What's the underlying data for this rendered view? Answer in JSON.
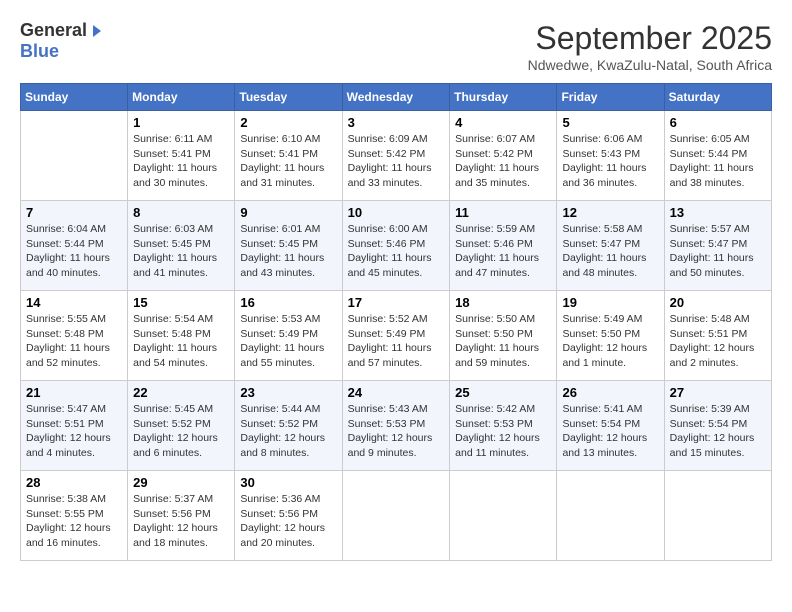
{
  "header": {
    "logo_general": "General",
    "logo_blue": "Blue",
    "month_title": "September 2025",
    "subtitle": "Ndwedwe, KwaZulu-Natal, South Africa"
  },
  "weekdays": [
    "Sunday",
    "Monday",
    "Tuesday",
    "Wednesday",
    "Thursday",
    "Friday",
    "Saturday"
  ],
  "weeks": [
    [
      {
        "day": "",
        "info": ""
      },
      {
        "day": "1",
        "info": "Sunrise: 6:11 AM\nSunset: 5:41 PM\nDaylight: 11 hours\nand 30 minutes."
      },
      {
        "day": "2",
        "info": "Sunrise: 6:10 AM\nSunset: 5:41 PM\nDaylight: 11 hours\nand 31 minutes."
      },
      {
        "day": "3",
        "info": "Sunrise: 6:09 AM\nSunset: 5:42 PM\nDaylight: 11 hours\nand 33 minutes."
      },
      {
        "day": "4",
        "info": "Sunrise: 6:07 AM\nSunset: 5:42 PM\nDaylight: 11 hours\nand 35 minutes."
      },
      {
        "day": "5",
        "info": "Sunrise: 6:06 AM\nSunset: 5:43 PM\nDaylight: 11 hours\nand 36 minutes."
      },
      {
        "day": "6",
        "info": "Sunrise: 6:05 AM\nSunset: 5:44 PM\nDaylight: 11 hours\nand 38 minutes."
      }
    ],
    [
      {
        "day": "7",
        "info": "Sunrise: 6:04 AM\nSunset: 5:44 PM\nDaylight: 11 hours\nand 40 minutes."
      },
      {
        "day": "8",
        "info": "Sunrise: 6:03 AM\nSunset: 5:45 PM\nDaylight: 11 hours\nand 41 minutes."
      },
      {
        "day": "9",
        "info": "Sunrise: 6:01 AM\nSunset: 5:45 PM\nDaylight: 11 hours\nand 43 minutes."
      },
      {
        "day": "10",
        "info": "Sunrise: 6:00 AM\nSunset: 5:46 PM\nDaylight: 11 hours\nand 45 minutes."
      },
      {
        "day": "11",
        "info": "Sunrise: 5:59 AM\nSunset: 5:46 PM\nDaylight: 11 hours\nand 47 minutes."
      },
      {
        "day": "12",
        "info": "Sunrise: 5:58 AM\nSunset: 5:47 PM\nDaylight: 11 hours\nand 48 minutes."
      },
      {
        "day": "13",
        "info": "Sunrise: 5:57 AM\nSunset: 5:47 PM\nDaylight: 11 hours\nand 50 minutes."
      }
    ],
    [
      {
        "day": "14",
        "info": "Sunrise: 5:55 AM\nSunset: 5:48 PM\nDaylight: 11 hours\nand 52 minutes."
      },
      {
        "day": "15",
        "info": "Sunrise: 5:54 AM\nSunset: 5:48 PM\nDaylight: 11 hours\nand 54 minutes."
      },
      {
        "day": "16",
        "info": "Sunrise: 5:53 AM\nSunset: 5:49 PM\nDaylight: 11 hours\nand 55 minutes."
      },
      {
        "day": "17",
        "info": "Sunrise: 5:52 AM\nSunset: 5:49 PM\nDaylight: 11 hours\nand 57 minutes."
      },
      {
        "day": "18",
        "info": "Sunrise: 5:50 AM\nSunset: 5:50 PM\nDaylight: 11 hours\nand 59 minutes."
      },
      {
        "day": "19",
        "info": "Sunrise: 5:49 AM\nSunset: 5:50 PM\nDaylight: 12 hours\nand 1 minute."
      },
      {
        "day": "20",
        "info": "Sunrise: 5:48 AM\nSunset: 5:51 PM\nDaylight: 12 hours\nand 2 minutes."
      }
    ],
    [
      {
        "day": "21",
        "info": "Sunrise: 5:47 AM\nSunset: 5:51 PM\nDaylight: 12 hours\nand 4 minutes."
      },
      {
        "day": "22",
        "info": "Sunrise: 5:45 AM\nSunset: 5:52 PM\nDaylight: 12 hours\nand 6 minutes."
      },
      {
        "day": "23",
        "info": "Sunrise: 5:44 AM\nSunset: 5:52 PM\nDaylight: 12 hours\nand 8 minutes."
      },
      {
        "day": "24",
        "info": "Sunrise: 5:43 AM\nSunset: 5:53 PM\nDaylight: 12 hours\nand 9 minutes."
      },
      {
        "day": "25",
        "info": "Sunrise: 5:42 AM\nSunset: 5:53 PM\nDaylight: 12 hours\nand 11 minutes."
      },
      {
        "day": "26",
        "info": "Sunrise: 5:41 AM\nSunset: 5:54 PM\nDaylight: 12 hours\nand 13 minutes."
      },
      {
        "day": "27",
        "info": "Sunrise: 5:39 AM\nSunset: 5:54 PM\nDaylight: 12 hours\nand 15 minutes."
      }
    ],
    [
      {
        "day": "28",
        "info": "Sunrise: 5:38 AM\nSunset: 5:55 PM\nDaylight: 12 hours\nand 16 minutes."
      },
      {
        "day": "29",
        "info": "Sunrise: 5:37 AM\nSunset: 5:56 PM\nDaylight: 12 hours\nand 18 minutes."
      },
      {
        "day": "30",
        "info": "Sunrise: 5:36 AM\nSunset: 5:56 PM\nDaylight: 12 hours\nand 20 minutes."
      },
      {
        "day": "",
        "info": ""
      },
      {
        "day": "",
        "info": ""
      },
      {
        "day": "",
        "info": ""
      },
      {
        "day": "",
        "info": ""
      }
    ]
  ]
}
